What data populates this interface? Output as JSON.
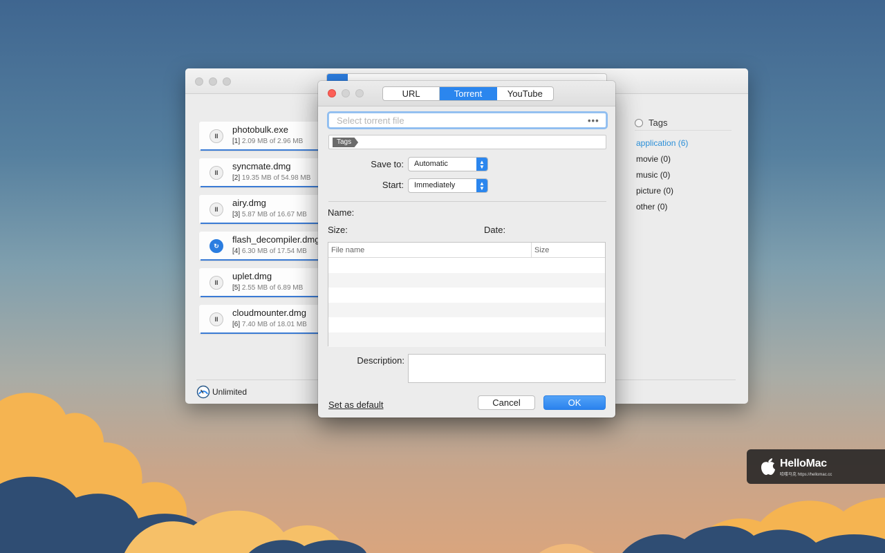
{
  "main_window": {
    "downloads": [
      {
        "name": "photobulk.exe",
        "index": "[1]",
        "progress": "2.09 MB of 2.96 MB",
        "state": "paused"
      },
      {
        "name": "syncmate.dmg",
        "index": "[2]",
        "progress": "19.35 MB of 54.98 MB",
        "state": "paused"
      },
      {
        "name": "airy.dmg",
        "index": "[3]",
        "progress": "5.87 MB of 16.67 MB",
        "state": "paused"
      },
      {
        "name": "flash_decompiler.dmg",
        "index": "[4]",
        "progress": "6.30 MB of 17.54 MB",
        "state": "resuming"
      },
      {
        "name": "uplet.dmg",
        "index": "[5]",
        "progress": "2.55 MB of 6.89 MB",
        "state": "paused"
      },
      {
        "name": "cloudmounter.dmg",
        "index": "[6]",
        "progress": "7.40 MB of 18.01 MB",
        "state": "paused"
      }
    ],
    "tags_header": "Tags",
    "tags": [
      {
        "label": "application",
        "count": "(6)",
        "selected": true
      },
      {
        "label": "movie",
        "count": "(0)",
        "selected": false
      },
      {
        "label": "music",
        "count": "(0)",
        "selected": false
      },
      {
        "label": "picture",
        "count": "(0)",
        "selected": false
      },
      {
        "label": "other",
        "count": "(0)",
        "selected": false
      }
    ],
    "speed_label": "Unlimited"
  },
  "dialog": {
    "tabs": [
      {
        "label": "URL",
        "active": false
      },
      {
        "label": "Torrent",
        "active": true
      },
      {
        "label": "YouTube",
        "active": false
      }
    ],
    "torrent_placeholder": "Select torrent file",
    "browse_label": "•••",
    "tags_chip": "Tags",
    "save_to_label": "Save to:",
    "save_to_value": "Automatic",
    "start_label": "Start:",
    "start_value": "Immediately",
    "name_label": "Name:",
    "size_label": "Size:",
    "date_label": "Date:",
    "table_headers": {
      "file_name": "File name",
      "size": "Size"
    },
    "description_label": "Description:",
    "set_default_label": "Set as default",
    "cancel_label": "Cancel",
    "ok_label": "OK"
  },
  "watermark": {
    "brand": "HelloMac",
    "subtitle": "哈喽马克 https://hellomac.cc"
  },
  "colors": {
    "accent": "#2b86ee",
    "tag_selected": "#2b8fd8",
    "close_red": "#fc5f57"
  },
  "icons": {
    "pause": "pause-icon",
    "resume": "refresh-icon",
    "speed": "speedometer-icon",
    "tags_radio": "radio-icon",
    "logo": "apple-logo-icon"
  }
}
